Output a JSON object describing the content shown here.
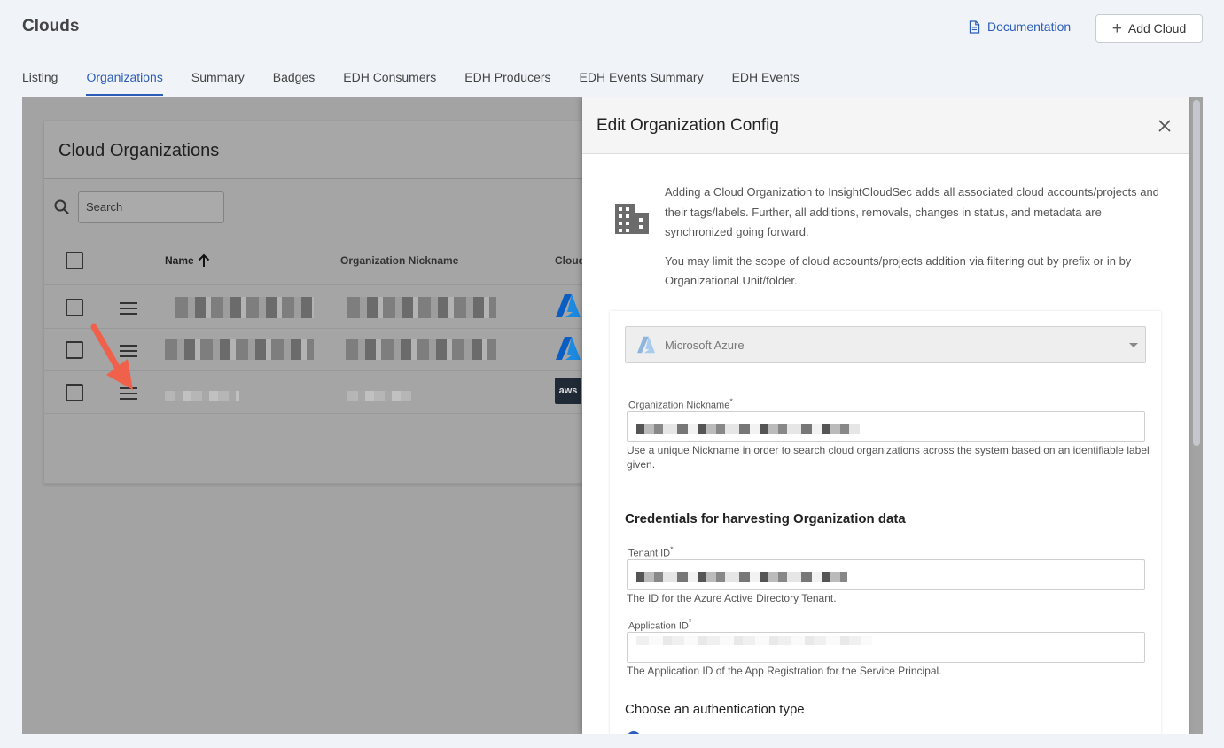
{
  "header": {
    "title": "Clouds",
    "documentation_label": "Documentation",
    "add_cloud_label": "Add Cloud"
  },
  "tabs": [
    {
      "label": "Listing",
      "active": false
    },
    {
      "label": "Organizations",
      "active": true
    },
    {
      "label": "Summary",
      "active": false
    },
    {
      "label": "Badges",
      "active": false
    },
    {
      "label": "EDH Consumers",
      "active": false
    },
    {
      "label": "EDH Producers",
      "active": false
    },
    {
      "label": "EDH Events Summary",
      "active": false
    },
    {
      "label": "EDH Events",
      "active": false
    }
  ],
  "org_list": {
    "title": "Cloud Organizations",
    "search_placeholder": "Search",
    "columns": {
      "name": "Name",
      "nickname": "Organization Nickname",
      "cloud": "Cloud"
    },
    "rows": [
      {
        "cloud": "azure-logo"
      },
      {
        "cloud": "azure-logo"
      },
      {
        "cloud": "aws-logo",
        "cloud_text": "aws"
      }
    ]
  },
  "panel": {
    "title": "Edit Organization Config",
    "intro_p1": "Adding a Cloud Organization to InsightCloudSec adds all associated cloud accounts/projects and their tags/labels. Further, all additions, removals, changes in status, and metadata are synchronized going forward.",
    "intro_p2": "You may limit the scope of cloud accounts/projects addition via filtering out by prefix or in by Organizational Unit/folder.",
    "provider": "Microsoft Azure",
    "nickname_label": "Organization Nickname",
    "nickname_help": "Use a unique Nickname in order to search cloud organizations across the system based on an identifiable label given.",
    "credentials_title": "Credentials for harvesting Organization data",
    "tenant_label": "Tenant ID",
    "tenant_help": "The ID for the Azure Active Directory Tenant.",
    "app_label": "Application ID",
    "app_help": "The Application ID of the App Registration for the Service Principal.",
    "auth_title": "Choose an authentication type",
    "required_mark": "*"
  },
  "colors": {
    "accent": "#2b5db8",
    "overlay": "#a3a3a3",
    "arrow": "#f0614b"
  }
}
